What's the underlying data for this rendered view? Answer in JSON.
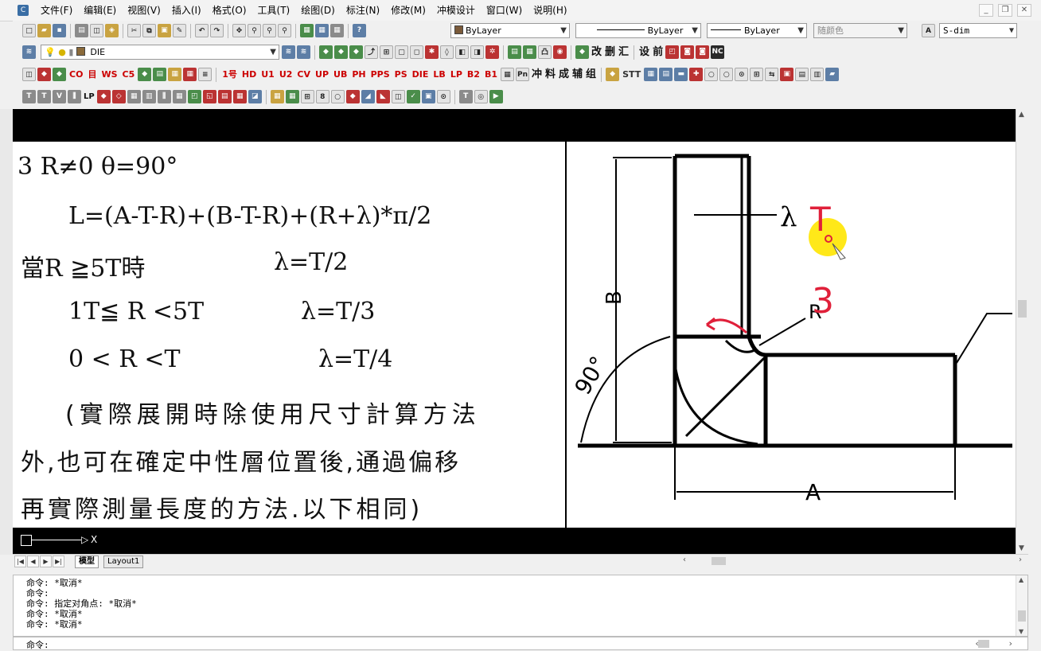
{
  "menu": [
    "文件(F)",
    "编辑(E)",
    "视图(V)",
    "插入(I)",
    "格式(O)",
    "工具(T)",
    "绘图(D)",
    "标注(N)",
    "修改(M)",
    "冲模设计",
    "窗口(W)",
    "说明(H)"
  ],
  "properties": {
    "color": "ByLayer",
    "linetype": "ByLayer",
    "lineweight": "ByLayer",
    "plotstyle": "随颜色",
    "dimstyle": "S-dim"
  },
  "layer": {
    "current": "DIE"
  },
  "toolbar_row3_labels": [
    "CO",
    "目",
    "WS",
    "1号",
    "HD",
    "U1",
    "U2",
    "CV",
    "UP",
    "UB",
    "PH",
    "PPS",
    "PS",
    "DIE",
    "LB",
    "LP",
    "B2",
    "B1",
    "冲",
    "料",
    "成",
    "辅",
    "组",
    "STT"
  ],
  "toolbar_row2_labels": [
    "改",
    "删",
    "汇",
    "设",
    "前",
    "NC"
  ],
  "toolbar_row4_labels": [
    "LP"
  ],
  "drawing": {
    "heading": "3 R≠0   θ=90°",
    "formula": "L=(A-T-R)+(B-T-R)+(R+λ)*π/2",
    "rules": [
      {
        "cond": "當R ≧5T時",
        "value": "λ=T/2"
      },
      {
        "cond": "1T≦ R <5T",
        "value": "λ=T/3"
      },
      {
        "cond": "0 < R <T",
        "value": "λ=T/4"
      }
    ],
    "note_lines": [
      "(實際展開時除使用尺寸計算方法",
      "外,也可在確定中性層位置後,通過偏移",
      "再實際測量長度的方法.以下相同)"
    ],
    "dim_labels": {
      "b": "B",
      "a": "A",
      "r": "R",
      "lambda": "λ",
      "angle": "90°",
      "t_mark": "T",
      "three": "3"
    },
    "accent_red": "#e0203a",
    "highlight_yellow": "#ffe600"
  },
  "tabs": {
    "model": "模型",
    "layout": "Layout1"
  },
  "ucs": {
    "x": "X"
  },
  "command": {
    "history": [
      "命令: *取消*",
      "命令:",
      "命令: 指定对角点: *取消*",
      "命令: *取消*",
      "命令: *取消*"
    ],
    "prompt": "命令:"
  }
}
